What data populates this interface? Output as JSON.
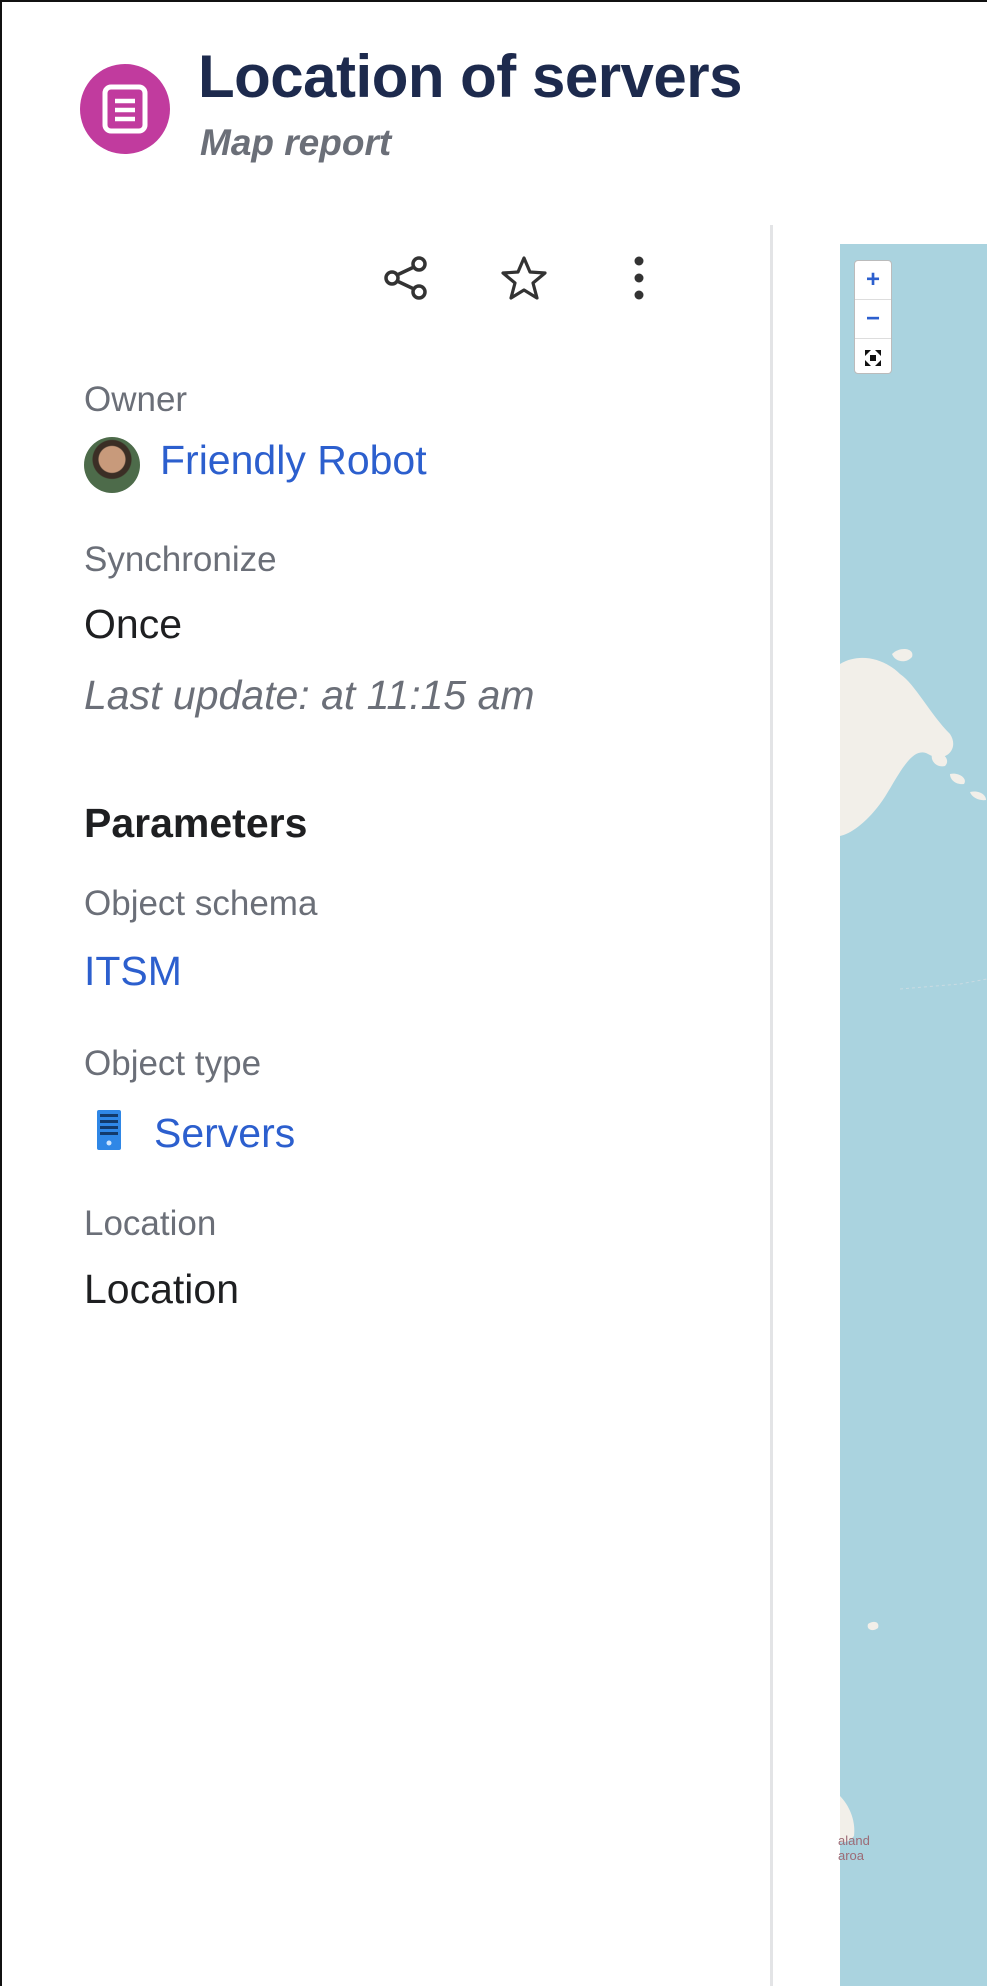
{
  "header": {
    "title": "Location of servers",
    "subtitle": "Map report",
    "icon": "report-document-icon"
  },
  "toolbar": {
    "share_icon": "share-icon",
    "star_icon": "star-icon",
    "more_icon": "more-vertical-icon"
  },
  "owner": {
    "label": "Owner",
    "name": "Friendly Robot"
  },
  "synchronize": {
    "label": "Synchronize",
    "value": "Once",
    "last_update": "Last update: at 11:15 am"
  },
  "parameters": {
    "title": "Parameters",
    "object_schema_label": "Object schema",
    "object_schema_value": "ITSM",
    "object_type_label": "Object type",
    "object_type_value": "Servers",
    "location_label": "Location",
    "location_value": "Location"
  },
  "map": {
    "zoom_in": "+",
    "zoom_out": "−",
    "fullscreen": "⛶",
    "place_label_1": "aland",
    "place_label_2": "aroa"
  },
  "colors": {
    "accent": "#c13b9e",
    "link": "#2c5fce",
    "water": "#aad3df",
    "land": "#f2efe9"
  }
}
